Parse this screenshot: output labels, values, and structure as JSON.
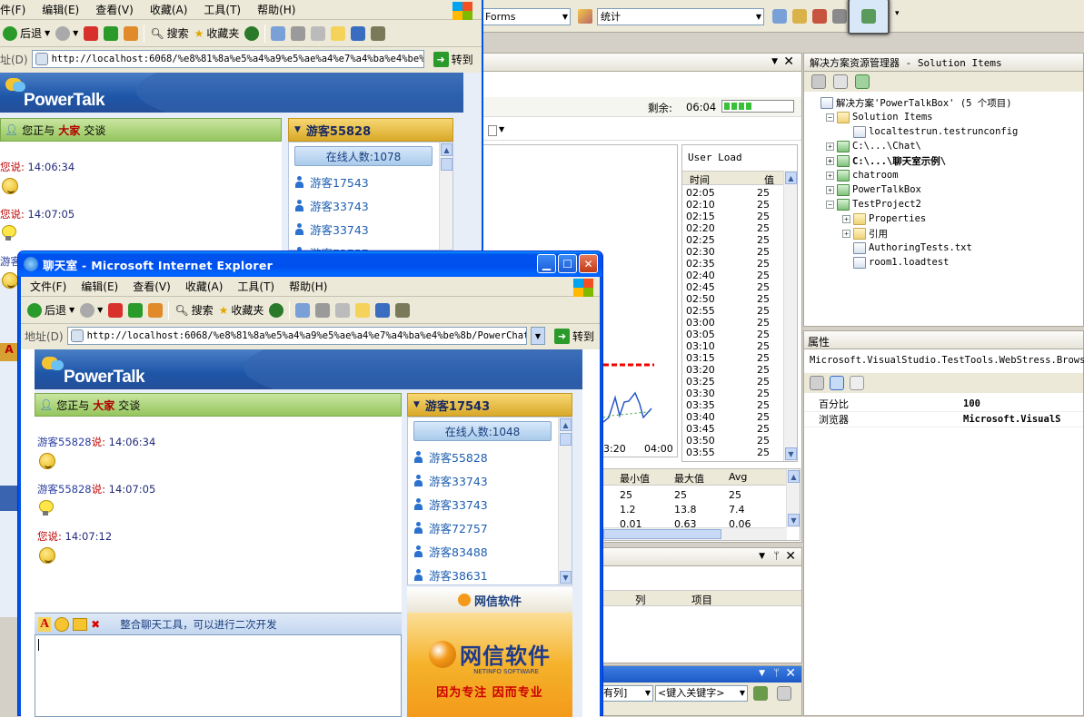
{
  "vs": {
    "toolbar_combo_left": "Forms",
    "toolbar_combo_right": "统计",
    "doc_remaining_label": "剩余:",
    "doc_remaining_value": "06:04",
    "user_load_title": "User Load",
    "table_headers": [
      "时间",
      "值"
    ],
    "table_rows": [
      [
        "02:05",
        "25"
      ],
      [
        "02:10",
        "25"
      ],
      [
        "02:15",
        "25"
      ],
      [
        "02:20",
        "25"
      ],
      [
        "02:25",
        "25"
      ],
      [
        "02:30",
        "25"
      ],
      [
        "02:35",
        "25"
      ],
      [
        "02:40",
        "25"
      ],
      [
        "02:45",
        "25"
      ],
      [
        "02:50",
        "25"
      ],
      [
        "02:55",
        "25"
      ],
      [
        "03:00",
        "25"
      ],
      [
        "03:05",
        "25"
      ],
      [
        "03:10",
        "25"
      ],
      [
        "03:15",
        "25"
      ],
      [
        "03:20",
        "25"
      ],
      [
        "03:25",
        "25"
      ],
      [
        "03:30",
        "25"
      ],
      [
        "03:35",
        "25"
      ],
      [
        "03:40",
        "25"
      ],
      [
        "03:45",
        "25"
      ],
      [
        "03:50",
        "25"
      ],
      [
        "03:55",
        "25"
      ]
    ],
    "chart_axis_labels": [
      "3:20",
      "04:00"
    ],
    "stats_headers": [
      "最小值",
      "最大值",
      "Avg"
    ],
    "stats_rows": [
      [
        "25",
        "25",
        "25"
      ],
      [
        "1.2",
        "13.8",
        "7.4"
      ],
      [
        "0.01",
        "0.63",
        "0.06"
      ]
    ],
    "errors_headers": [
      "列",
      "项目"
    ],
    "find_combo1": "有列]",
    "find_combo2": "<键入关键字>",
    "solution": {
      "title": "解决方案资源管理器 - Solution Items",
      "items": [
        {
          "indent": 0,
          "exp": "",
          "icon": "doc",
          "label": "解决方案'PowerTalkBox' (5 个项目)",
          "bold": false
        },
        {
          "indent": 1,
          "exp": "−",
          "icon": "folder",
          "label": "Solution Items",
          "bold": false
        },
        {
          "indent": 2,
          "exp": "",
          "icon": "doc",
          "label": "localtestrun.testrunconfig",
          "bold": false
        },
        {
          "indent": 1,
          "exp": "+",
          "icon": "cs",
          "label": "C:\\...\\Chat\\",
          "bold": false
        },
        {
          "indent": 1,
          "exp": "+",
          "icon": "cs",
          "label": "C:\\...\\聊天室示例\\",
          "bold": true
        },
        {
          "indent": 1,
          "exp": "+",
          "icon": "cs",
          "label": "chatroom",
          "bold": false
        },
        {
          "indent": 1,
          "exp": "+",
          "icon": "cs",
          "label": "PowerTalkBox",
          "bold": false
        },
        {
          "indent": 1,
          "exp": "−",
          "icon": "cs",
          "label": "TestProject2",
          "bold": false
        },
        {
          "indent": 2,
          "exp": "+",
          "icon": "folder",
          "label": "Properties",
          "bold": false
        },
        {
          "indent": 2,
          "exp": "+",
          "icon": "folder",
          "label": "引用",
          "bold": false
        },
        {
          "indent": 2,
          "exp": "",
          "icon": "doc",
          "label": "AuthoringTests.txt",
          "bold": false
        },
        {
          "indent": 2,
          "exp": "",
          "icon": "doc",
          "label": "room1.loadtest",
          "bold": false
        }
      ]
    },
    "props": {
      "title": "属性",
      "object": "Microsoft.VisualStudio.TestTools.WebStress.Browser",
      "rows": [
        [
          "百分比",
          "100"
        ],
        [
          "浏览器",
          "Microsoft.VisualS"
        ]
      ]
    }
  },
  "back_ie": {
    "menu": [
      "件(F)",
      "编辑(E)",
      "查看(V)",
      "收藏(A)",
      "工具(T)",
      "帮助(H)"
    ],
    "back": "后退",
    "search": "搜索",
    "favorites": "收藏夹",
    "addr_label": "址(D)",
    "url": "http://localhost:6068/%e8%81%8a%e5%a4%a9%e5%ae%a4%e7%a4%ba%e4%be%8b",
    "go": "转到",
    "brand": "PowerTalk",
    "chat_with": "您正与",
    "chat_target": "大家",
    "chat_suffix": "交谈",
    "user_title": "游客55828",
    "online": "在线人数:1078",
    "users": [
      "游客17543",
      "游客33743",
      "游客33743",
      "游客72757"
    ],
    "messages": [
      {
        "who": "您",
        "time": "14:06:34",
        "icon": "face"
      },
      {
        "who": "您",
        "time": "14:07:05",
        "icon": "bulb"
      },
      {
        "who": "游客17543",
        "time": "14:07:12",
        "icon": "face"
      }
    ]
  },
  "front_ie": {
    "title": "聊天室 - Microsoft Internet Explorer",
    "menu": [
      "文件(F)",
      "编辑(E)",
      "查看(V)",
      "收藏(A)",
      "工具(T)",
      "帮助(H)"
    ],
    "back": "后退",
    "search": "搜索",
    "favorites": "收藏夹",
    "addr_label": "地址(D)",
    "url": "http://localhost:6068/%e8%81%8a%e5%a4%a9%e5%ae%a4%e7%a4%ba%e4%be%8b/PowerChatRoom",
    "go": "转到",
    "brand": "PowerTalk",
    "chat_with": "您正与",
    "chat_target": "大家",
    "chat_suffix": "交谈",
    "user_title": "游客17543",
    "online": "在线人数:1048",
    "users": [
      "游客55828",
      "游客33743",
      "游客33743",
      "游客72757",
      "游客83488",
      "游客38631"
    ],
    "messages": [
      {
        "who": "游客55828",
        "self": false,
        "said": "说:",
        "time": "14:06:34",
        "icon": "face"
      },
      {
        "who": "游客55828",
        "self": false,
        "said": "说:",
        "time": "14:07:05",
        "icon": "bulb"
      },
      {
        "who": "您",
        "self": true,
        "said": "说:",
        "time": "14:07:12",
        "icon": "face"
      }
    ],
    "input_tip": "整合聊天工具，可以进行二次开发",
    "ad_brand": "网信软件",
    "ad_big": "网信软件",
    "ad_sub": "NETINFO SOFTWARE",
    "ad_slogan": "因为专注 因而专业"
  }
}
